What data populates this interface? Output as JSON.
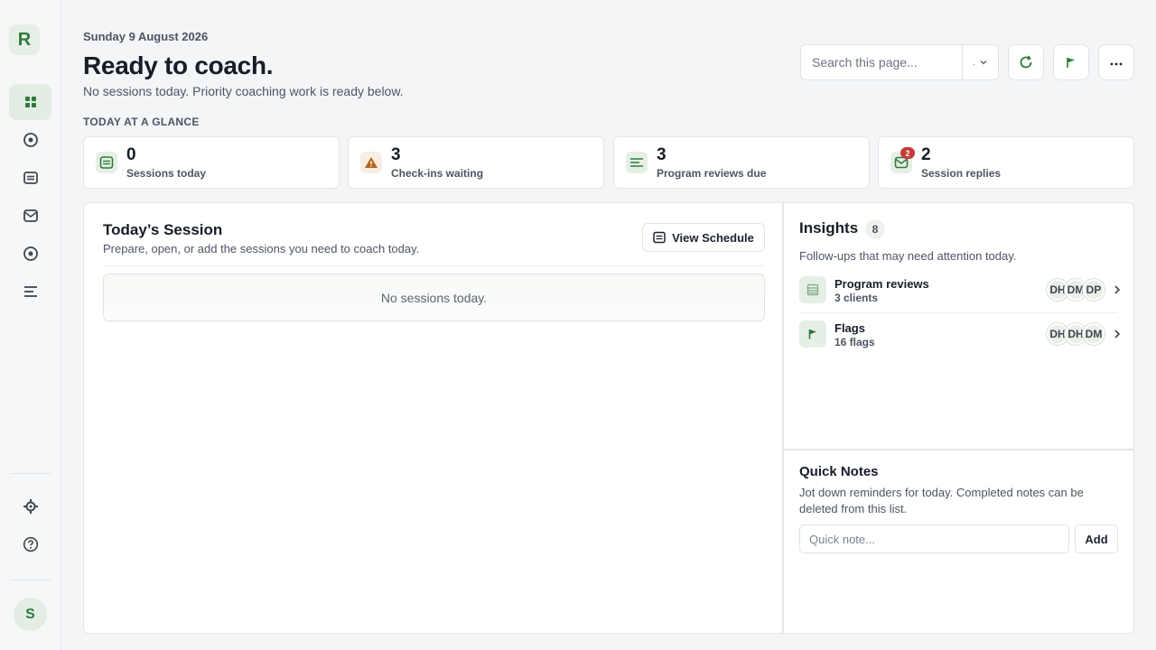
{
  "app": {
    "logo_letter": "R",
    "user_initial": "S"
  },
  "sidebar": {
    "items": [
      {
        "name": "dashboard-grid-icon",
        "active": true
      },
      {
        "name": "target-icon",
        "active": false
      },
      {
        "name": "schedule-icon",
        "active": false
      },
      {
        "name": "inbox-icon",
        "active": false
      },
      {
        "name": "record-icon",
        "active": false
      },
      {
        "name": "list-lines-icon",
        "active": false
      }
    ],
    "bottom": [
      "settings-icon",
      "help-icon"
    ]
  },
  "header": {
    "date": "Sunday 9 August 2026",
    "title": "Ready to coach.",
    "subtitle": "No sessions today. Priority coaching work is ready below.",
    "search_placeholder": "Search this page...",
    "search_scope": "."
  },
  "glance": {
    "label": "TODAY AT A GLANCE",
    "cards": [
      {
        "value": "0",
        "label": "Sessions today",
        "icon": "schedule-icon"
      },
      {
        "value": "3",
        "label": "Check-ins waiting",
        "icon": "warning-icon"
      },
      {
        "value": "3",
        "label": "Program reviews due",
        "icon": "list-lines-icon"
      },
      {
        "value": "2",
        "label": "Session replies",
        "icon": "inbox-icon",
        "badge": "2"
      }
    ]
  },
  "session": {
    "title": "Today’s Session",
    "subtitle": "Prepare, open, or add the sessions you need to coach today.",
    "view_button": "View Schedule",
    "empty_text": "No sessions today."
  },
  "insights": {
    "title": "Insights",
    "count": "8",
    "subtitle": "Follow-ups that may need attention today.",
    "items": [
      {
        "title": "Program reviews",
        "sub": "3 clients",
        "icon": "list-icon",
        "avatars": [
          "DH",
          "DM",
          "DP"
        ]
      },
      {
        "title": "Flags",
        "sub": "16 flags",
        "icon": "flag-icon",
        "avatars": [
          "DH",
          "DH",
          "DM"
        ]
      }
    ]
  },
  "notes": {
    "title": "Quick Notes",
    "subtitle": "Jot down reminders for today. Completed notes can be deleted from this list.",
    "placeholder": "Quick note...",
    "add_label": "Add"
  },
  "colors": {
    "accent": "#2f7a3a",
    "warning": "#b5651d",
    "badge": "#c23b34"
  }
}
